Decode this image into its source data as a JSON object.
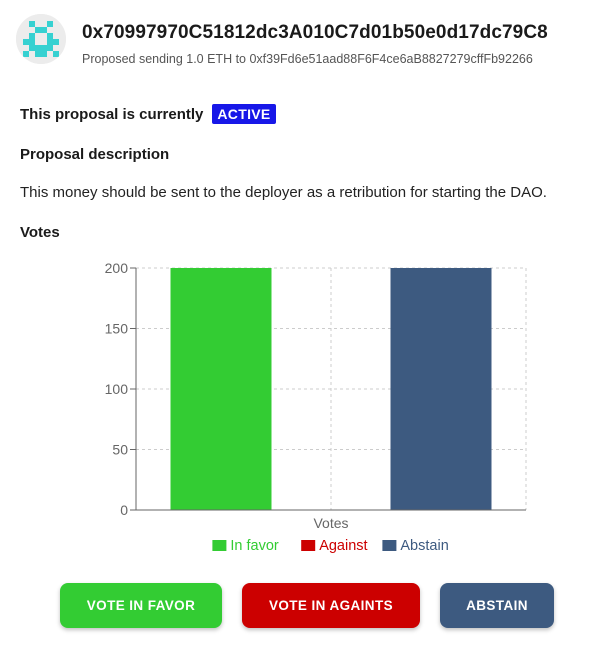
{
  "header": {
    "address": "0x70997970C51812dc3A010C7d01b50e0d17dc79C8",
    "subtitle": "Proposed sending 1.0 ETH to 0xf39Fd6e51aad88F6F4ce6aB8827279cffFb92266"
  },
  "status": {
    "label": "This proposal is currently",
    "badge": "ACTIVE",
    "badge_color": "#1717e8"
  },
  "description": {
    "heading": "Proposal description",
    "text": "This money should be sent to the deployer as a retribution for starting the DAO."
  },
  "votes": {
    "heading": "Votes"
  },
  "chart_data": {
    "type": "bar",
    "categories": [
      "Votes"
    ],
    "xlabel": "",
    "ylabel": "",
    "ylim": [
      0,
      200
    ],
    "yticks": [
      0,
      50,
      100,
      150,
      200
    ],
    "grid": true,
    "legend_position": "bottom",
    "series": [
      {
        "name": "In favor",
        "values": [
          200
        ],
        "color": "#33cc33"
      },
      {
        "name": "Against",
        "values": [
          0
        ],
        "color": "#cc0000"
      },
      {
        "name": "Abstain",
        "values": [
          200
        ],
        "color": "#3d5a80"
      }
    ]
  },
  "actions": {
    "favor": "VOTE IN FAVOR",
    "against": "VOTE IN AGAINTS",
    "abstain": "ABSTAIN"
  }
}
